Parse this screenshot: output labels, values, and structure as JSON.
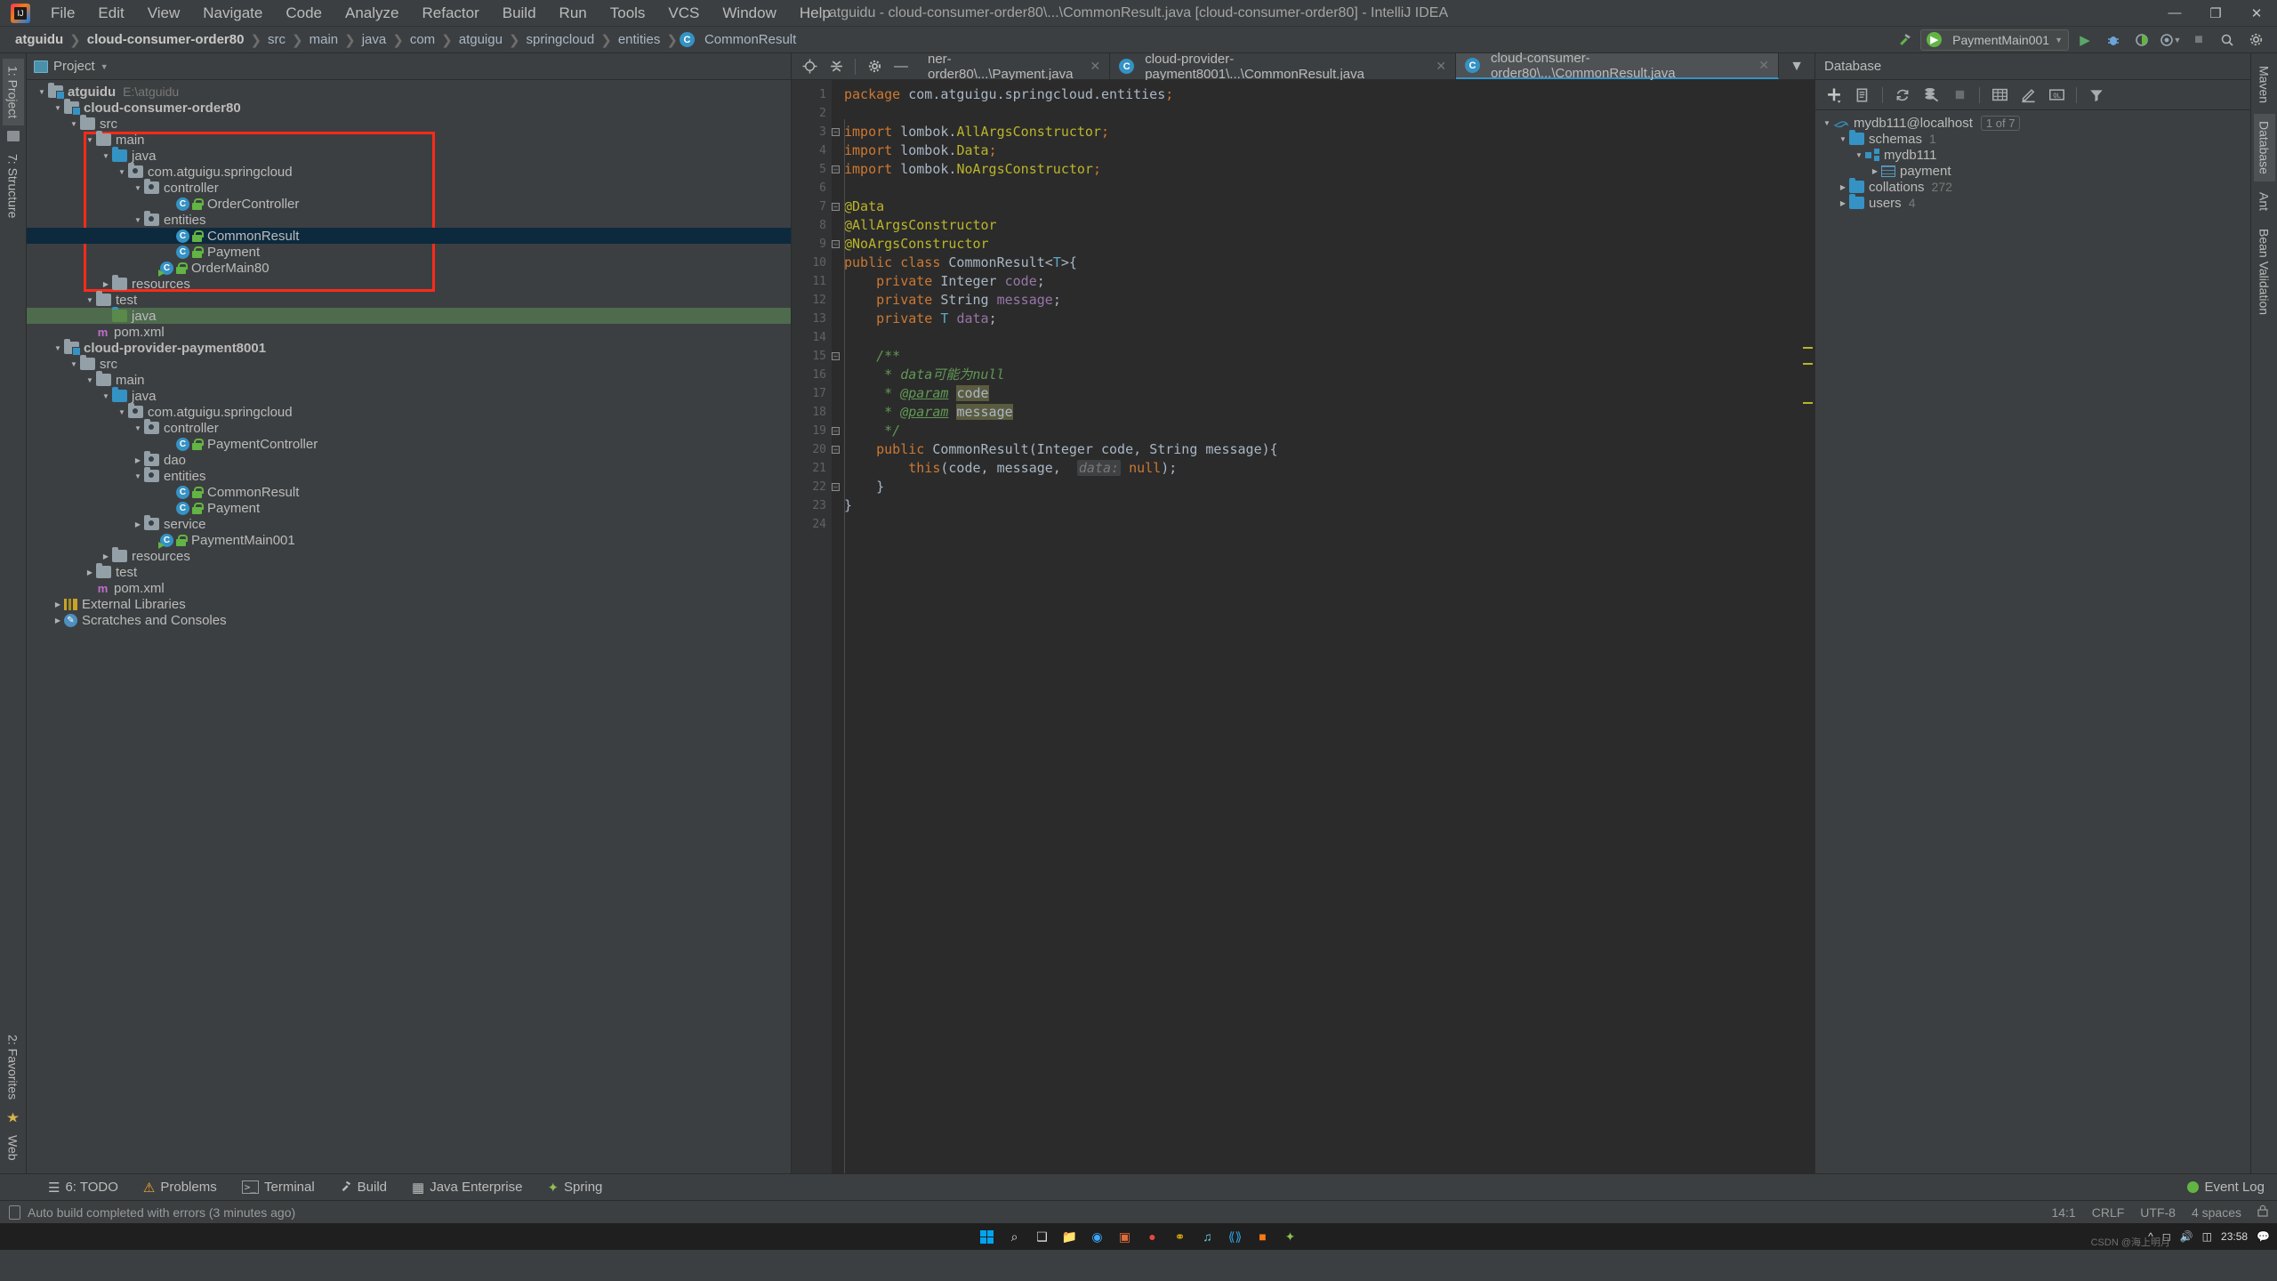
{
  "window": {
    "title": "atguidu - cloud-consumer-order80\\...\\CommonResult.java [cloud-consumer-order80] - IntelliJ IDEA",
    "minimize": "—",
    "maximize": "❐",
    "close": "✕"
  },
  "menubar": [
    "File",
    "Edit",
    "View",
    "Navigate",
    "Code",
    "Analyze",
    "Refactor",
    "Build",
    "Run",
    "Tools",
    "VCS",
    "Window",
    "Help"
  ],
  "breadcrumb": [
    {
      "label": "atguidu",
      "bold": true
    },
    {
      "label": "cloud-consumer-order80",
      "bold": true
    },
    {
      "label": "src",
      "bold": false
    },
    {
      "label": "main",
      "bold": false
    },
    {
      "label": "java",
      "bold": false
    },
    {
      "label": "com",
      "bold": false
    },
    {
      "label": "atguigu",
      "bold": false
    },
    {
      "label": "springcloud",
      "bold": false
    },
    {
      "label": "entities",
      "bold": false
    }
  ],
  "breadcrumb_class": {
    "badge": "C",
    "label": "CommonResult"
  },
  "navbar_right": {
    "run_config": "PaymentMain001",
    "run": "▶",
    "debug": "🐞",
    "coverage": "◑",
    "profile": "◔",
    "stop": "■",
    "search": "⌕",
    "settings": "⚙",
    "minimize": "—"
  },
  "left_rail": {
    "top": "1: Project",
    "mid": "7: Structure",
    "bottom1": "2: Favorites",
    "bottom2": "Web"
  },
  "right_rail": {
    "maven": "Maven",
    "database": "Database",
    "ant": "Ant",
    "bean": "Bean Validation"
  },
  "project_panel": {
    "title": "Project",
    "tree": [
      {
        "indent": 0,
        "arrow": "▼",
        "icon": "folder-module",
        "label": "atguidu",
        "bold": true,
        "dim": "E:\\atguidu",
        "sel": ""
      },
      {
        "indent": 1,
        "arrow": "▼",
        "icon": "folder-module",
        "label": "cloud-consumer-order80",
        "bold": true,
        "dim": "",
        "sel": ""
      },
      {
        "indent": 2,
        "arrow": "▼",
        "icon": "folder-gray",
        "label": "src",
        "bold": false,
        "dim": "",
        "sel": ""
      },
      {
        "indent": 3,
        "arrow": "▼",
        "icon": "folder-gray",
        "label": "main",
        "bold": false,
        "dim": "",
        "sel": ""
      },
      {
        "indent": 4,
        "arrow": "▼",
        "icon": "folder-blue",
        "label": "java",
        "bold": false,
        "dim": "",
        "sel": ""
      },
      {
        "indent": 5,
        "arrow": "▼",
        "icon": "folder-pkg",
        "label": "com.atguigu.springcloud",
        "bold": false,
        "dim": "",
        "sel": ""
      },
      {
        "indent": 6,
        "arrow": "▼",
        "icon": "folder-pkg",
        "label": "controller",
        "bold": false,
        "dim": "",
        "sel": ""
      },
      {
        "indent": 8,
        "arrow": "",
        "icon": "class-lock",
        "label": "OrderController",
        "bold": false,
        "dim": "",
        "sel": ""
      },
      {
        "indent": 6,
        "arrow": "▼",
        "icon": "folder-pkg",
        "label": "entities",
        "bold": false,
        "dim": "",
        "sel": ""
      },
      {
        "indent": 8,
        "arrow": "",
        "icon": "class-lock",
        "label": "CommonResult",
        "bold": false,
        "dim": "",
        "sel": "blue"
      },
      {
        "indent": 8,
        "arrow": "",
        "icon": "class-lock",
        "label": "Payment",
        "bold": false,
        "dim": "",
        "sel": ""
      },
      {
        "indent": 7,
        "arrow": "",
        "icon": "class-run",
        "label": "OrderMain80",
        "bold": false,
        "dim": "",
        "sel": ""
      },
      {
        "indent": 4,
        "arrow": "▶",
        "icon": "folder-gray",
        "label": "resources",
        "bold": false,
        "dim": "",
        "sel": ""
      },
      {
        "indent": 3,
        "arrow": "▼",
        "icon": "folder-gray",
        "label": "test",
        "bold": false,
        "dim": "",
        "sel": ""
      },
      {
        "indent": 4,
        "arrow": "",
        "icon": "folder-green",
        "label": "java",
        "bold": false,
        "dim": "",
        "sel": "green"
      },
      {
        "indent": 3,
        "arrow": "",
        "icon": "maven",
        "label": "pom.xml",
        "bold": false,
        "dim": "",
        "sel": ""
      },
      {
        "indent": 1,
        "arrow": "▼",
        "icon": "folder-module",
        "label": "cloud-provider-payment8001",
        "bold": true,
        "dim": "",
        "sel": ""
      },
      {
        "indent": 2,
        "arrow": "▼",
        "icon": "folder-gray",
        "label": "src",
        "bold": false,
        "dim": "",
        "sel": ""
      },
      {
        "indent": 3,
        "arrow": "▼",
        "icon": "folder-gray",
        "label": "main",
        "bold": false,
        "dim": "",
        "sel": ""
      },
      {
        "indent": 4,
        "arrow": "▼",
        "icon": "folder-blue",
        "label": "java",
        "bold": false,
        "dim": "",
        "sel": ""
      },
      {
        "indent": 5,
        "arrow": "▼",
        "icon": "folder-pkg",
        "label": "com.atguigu.springcloud",
        "bold": false,
        "dim": "",
        "sel": ""
      },
      {
        "indent": 6,
        "arrow": "▼",
        "icon": "folder-pkg",
        "label": "controller",
        "bold": false,
        "dim": "",
        "sel": ""
      },
      {
        "indent": 8,
        "arrow": "",
        "icon": "class-lock",
        "label": "PaymentController",
        "bold": false,
        "dim": "",
        "sel": ""
      },
      {
        "indent": 6,
        "arrow": "▶",
        "icon": "folder-pkg",
        "label": "dao",
        "bold": false,
        "dim": "",
        "sel": ""
      },
      {
        "indent": 6,
        "arrow": "▼",
        "icon": "folder-pkg",
        "label": "entities",
        "bold": false,
        "dim": "",
        "sel": ""
      },
      {
        "indent": 8,
        "arrow": "",
        "icon": "class-lock",
        "label": "CommonResult",
        "bold": false,
        "dim": "",
        "sel": ""
      },
      {
        "indent": 8,
        "arrow": "",
        "icon": "class-lock",
        "label": "Payment",
        "bold": false,
        "dim": "",
        "sel": ""
      },
      {
        "indent": 6,
        "arrow": "▶",
        "icon": "folder-pkg",
        "label": "service",
        "bold": false,
        "dim": "",
        "sel": ""
      },
      {
        "indent": 7,
        "arrow": "",
        "icon": "class-run",
        "label": "PaymentMain001",
        "bold": false,
        "dim": "",
        "sel": ""
      },
      {
        "indent": 4,
        "arrow": "▶",
        "icon": "folder-gray",
        "label": "resources",
        "bold": false,
        "dim": "",
        "sel": ""
      },
      {
        "indent": 3,
        "arrow": "▶",
        "icon": "folder-gray",
        "label": "test",
        "bold": false,
        "dim": "",
        "sel": ""
      },
      {
        "indent": 3,
        "arrow": "",
        "icon": "maven",
        "label": "pom.xml",
        "bold": false,
        "dim": "",
        "sel": ""
      },
      {
        "indent": 1,
        "arrow": "▶",
        "icon": "library",
        "label": "External Libraries",
        "bold": false,
        "dim": "",
        "sel": ""
      },
      {
        "indent": 1,
        "arrow": "▶",
        "icon": "scratch",
        "label": "Scratches and Consoles",
        "bold": false,
        "dim": "",
        "sel": ""
      }
    ]
  },
  "editor": {
    "toolbar": {
      "locate": "⊕",
      "collapse": "⩒",
      "settings": "⚙",
      "hide": "—"
    },
    "tabs": [
      {
        "label": "ner-order80\\...\\Payment.java",
        "active": false,
        "icon": ""
      },
      {
        "label": "cloud-provider-payment8001\\...\\CommonResult.java",
        "active": false,
        "icon": "C"
      },
      {
        "label": "cloud-consumer-order80\\...\\CommonResult.java",
        "active": true,
        "icon": "C"
      }
    ],
    "lines": [
      {
        "n": 1,
        "fold": "",
        "html": "<span class=\"kw\">package</span> com.atguigu.springcloud.entities<span class=\"kw\">;</span>"
      },
      {
        "n": 2,
        "fold": "",
        "html": ""
      },
      {
        "n": 3,
        "fold": "-",
        "html": "<span class=\"kw\">import</span> lombok.<span class=\"ann\">AllArgsConstructor</span><span class=\"kw\">;</span>"
      },
      {
        "n": 4,
        "fold": "",
        "html": "<span class=\"kw\">import</span> lombok.<span class=\"ann\">Data</span><span class=\"kw\">;</span>"
      },
      {
        "n": 5,
        "fold": "=",
        "html": "<span class=\"kw\">import</span> lombok.<span class=\"ann\">NoArgsConstructor</span><span class=\"kw\">;</span>"
      },
      {
        "n": 6,
        "fold": "",
        "html": ""
      },
      {
        "n": 7,
        "fold": "-",
        "html": "<span class=\"ann\">@Data</span>"
      },
      {
        "n": 8,
        "fold": "",
        "html": "<span class=\"ann\">@AllArgsConstructor</span>"
      },
      {
        "n": 9,
        "fold": "=",
        "html": "<span class=\"ann\">@NoArgsConstructor</span>"
      },
      {
        "n": 10,
        "fold": "",
        "html": "<span class=\"kw\">public class</span> <span class=\"typ\">CommonResult</span>&lt;<span class=\"gen\">T</span>&gt;{"
      },
      {
        "n": 11,
        "fold": "",
        "html": "    <span class=\"kw\">private</span> <span class=\"typ\">Integer</span> <span class=\"fldv\">code</span>;"
      },
      {
        "n": 12,
        "fold": "",
        "html": "    <span class=\"kw\">private</span> <span class=\"typ\">String</span> <span class=\"fldv\">message</span>;"
      },
      {
        "n": 13,
        "fold": "",
        "html": "    <span class=\"kw\">private</span> <span class=\"gen\">T</span> <span class=\"fldv\">data</span>;"
      },
      {
        "n": 14,
        "fold": "",
        "html": "<span class=\"cursor\"></span>"
      },
      {
        "n": 15,
        "fold": "-",
        "html": "    <span class=\"cmt\">/**</span>"
      },
      {
        "n": 16,
        "fold": "",
        "html": "     <span class=\"cmt\">* data可能为null</span>"
      },
      {
        "n": 17,
        "fold": "",
        "html": "     <span class=\"cmt\">* </span><span class=\"cmt-tag\">@param</span> <span class=\"param-hl\">code</span>"
      },
      {
        "n": 18,
        "fold": "",
        "html": "     <span class=\"cmt\">* </span><span class=\"cmt-tag\">@param</span> <span class=\"param-hl\">message</span>"
      },
      {
        "n": 19,
        "fold": "=",
        "html": "     <span class=\"cmt\">*/</span>"
      },
      {
        "n": 20,
        "fold": "-",
        "html": "    <span class=\"kw\">public</span> <span class=\"typ\">CommonResult</span>(<span class=\"typ\">Integer</span> code, <span class=\"typ\">String</span> message){"
      },
      {
        "n": 21,
        "fold": "",
        "html": "        <span class=\"kw\">this</span>(code, message,  <span class=\"hint\">data:</span> <span class=\"kw\">null</span>);"
      },
      {
        "n": 22,
        "fold": "=",
        "html": "    }"
      },
      {
        "n": 23,
        "fold": "",
        "html": "}"
      },
      {
        "n": 24,
        "fold": "",
        "html": ""
      }
    ]
  },
  "database_panel": {
    "title": "Database",
    "toolbar": {
      "add": "＋",
      "copy": "❐",
      "refresh": "⟳",
      "datasource": "☷",
      "stop": "■",
      "table": "▦",
      "edit": "✎",
      "console": "QL",
      "filter": "▼"
    },
    "tree": [
      {
        "indent": 0,
        "arrow": "▼",
        "icon": "mysql",
        "label": "mydb111@localhost",
        "chip": "1 of 7",
        "count": ""
      },
      {
        "indent": 1,
        "arrow": "▼",
        "icon": "folder-blue",
        "label": "schemas",
        "chip": "",
        "count": "1"
      },
      {
        "indent": 2,
        "arrow": "▼",
        "icon": "schema",
        "label": "mydb111",
        "chip": "",
        "count": ""
      },
      {
        "indent": 3,
        "arrow": "▶",
        "icon": "table",
        "label": "payment",
        "chip": "",
        "count": ""
      },
      {
        "indent": 1,
        "arrow": "▶",
        "icon": "folder-blue",
        "label": "collations",
        "chip": "",
        "count": "272"
      },
      {
        "indent": 1,
        "arrow": "▶",
        "icon": "folder-blue",
        "label": "users",
        "chip": "",
        "count": "4"
      }
    ]
  },
  "bottom_toolstrip": [
    {
      "icon": "☰",
      "label": "6: TODO"
    },
    {
      "icon": "⚠",
      "label": "Problems"
    },
    {
      "icon": "⬛",
      "label": "Terminal"
    },
    {
      "icon": "🔨",
      "label": "Build"
    },
    {
      "icon": "☰",
      "label": "Java Enterprise"
    },
    {
      "icon": "🍃",
      "label": "Spring"
    }
  ],
  "event_log": {
    "label": "Event Log"
  },
  "statusbar": {
    "message": "Auto build completed with errors (3 minutes ago)",
    "position": "14:1",
    "line_sep": "CRLF",
    "encoding": "UTF-8",
    "indent": "4 spaces",
    "lock": "🔒"
  },
  "taskbar": {
    "search": "⌕",
    "taskview": "❑",
    "apps": [
      "📁",
      "🌐",
      "💼",
      "●",
      "🔍",
      "🎵",
      "⬤",
      "⬛",
      "🌿"
    ],
    "clock_time": "23:58",
    "clock_date": "",
    "watermark": "CSDN @海上明月"
  }
}
